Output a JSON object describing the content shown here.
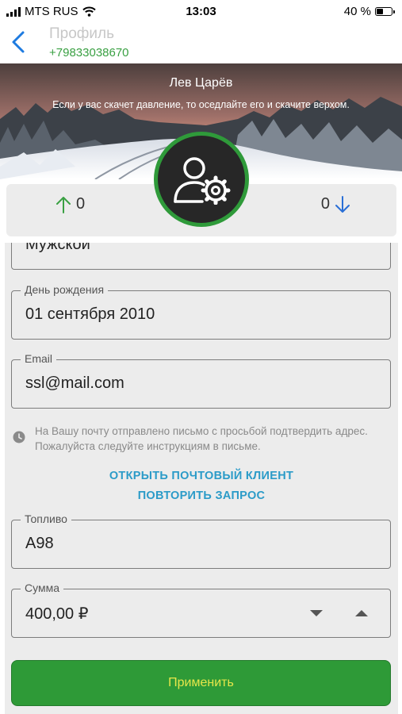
{
  "status_bar": {
    "carrier": "MTS RUS",
    "time": "13:03",
    "battery_text": "40 %",
    "battery_level": 0.4
  },
  "nav": {
    "title": "Профиль",
    "phone": "+79833038670"
  },
  "banner": {
    "name": "Лев Царёв",
    "quote": "Если у вас скачет давление, то оседлайте его и скачите верхом."
  },
  "stats": {
    "up_count": "0",
    "down_count": "0",
    "up_color": "#3aa043",
    "down_color": "#2a6fd6"
  },
  "icons": {
    "back": "chevron-left-icon",
    "avatar": "user-settings-icon",
    "up": "arrow-up-icon",
    "down": "arrow-down-icon",
    "info": "clock-icon"
  },
  "form": {
    "gender": {
      "value": "Мужской"
    },
    "birthday": {
      "label": "День рождения",
      "value": "01 сентября 2010"
    },
    "email": {
      "label": "Email",
      "value": "ssl@mail.com"
    },
    "email_note": "На Вашу почту отправлено письмо с просьбой подтвердить адрес. Пожалуйста следуйте инструкциям в письме.",
    "open_mail_label": "ОТКРЫТЬ ПОЧТОВЫЙ КЛИЕНТ",
    "repeat_request_label": "ПОВТОРИТЬ ЗАПРОС",
    "fuel": {
      "label": "Топливо",
      "value": "A98"
    },
    "amount": {
      "label": "Сумма",
      "value": "400,00 ₽"
    },
    "apply_label": "Применить"
  },
  "colors": {
    "accent_green": "#2e9a37",
    "link_blue": "#2b9bc8",
    "apply_text": "#e6e64a"
  }
}
